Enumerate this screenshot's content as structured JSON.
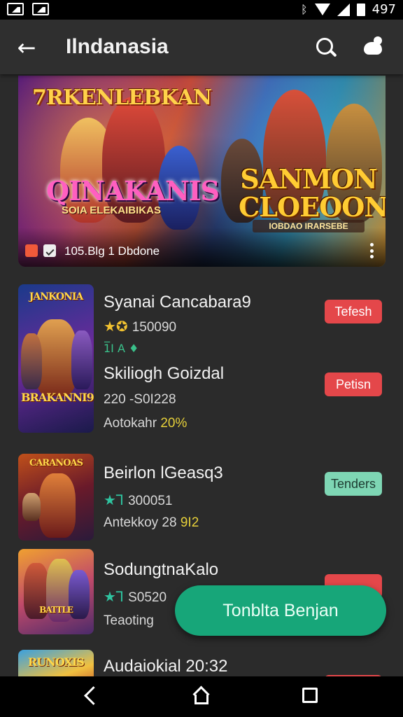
{
  "status_bar": {
    "time": "497",
    "icons": [
      "gallery-icon",
      "image-icon",
      "bluetooth-icon",
      "wifi-icon",
      "signal-icon",
      "battery-icon"
    ]
  },
  "app_bar": {
    "title": "Ilndanasia",
    "back_icon": "back-arrow-icon",
    "search_icon": "search-icon",
    "more_icon": "cloud-icon"
  },
  "banner": {
    "logo_top_left": "7RKENLEBKAN",
    "logo_left": "QINAKANIS",
    "logo_left_sub": "SOIA ELEKAIBIKAS",
    "logo_right": "SANMON CLOEOONS",
    "logo_right_sub": "IOBDAO IRARSEBE",
    "footer_text": "105.Blg  1 Dbdone"
  },
  "items": [
    {
      "title": "Syanai Cancabara9",
      "rating_text": "150090",
      "star_color": "yellow",
      "mark": "1̅I A  ♦",
      "subtitle": "Skiliogh Goizdal",
      "line1": "220  -S0I228",
      "line2_prefix": "Aotokahr",
      "line2_highlight": "20%",
      "button1": "Tefesh",
      "button2": "Petisn"
    },
    {
      "title": "Beirlon lGeasq3",
      "rating_text": "300051",
      "star_color": "green",
      "line2_prefix": "Antekkoy  28",
      "line2_highlight": "9I2",
      "button1": "Tenders"
    },
    {
      "title": "SodungtnaKalo",
      "rating_text": "S0520",
      "star_color": "green",
      "line2_prefix": "Teaoting"
    },
    {
      "title": "Audaiokial 20:32"
    }
  ],
  "fab_label": "Tonblta Benjan",
  "colors": {
    "background": "#2b2b2b",
    "fab": "#17a679",
    "button_red": "#e4474a",
    "button_green": "#7ed6b4",
    "star_yellow": "#f2c230",
    "star_green": "#2fc4a0"
  }
}
